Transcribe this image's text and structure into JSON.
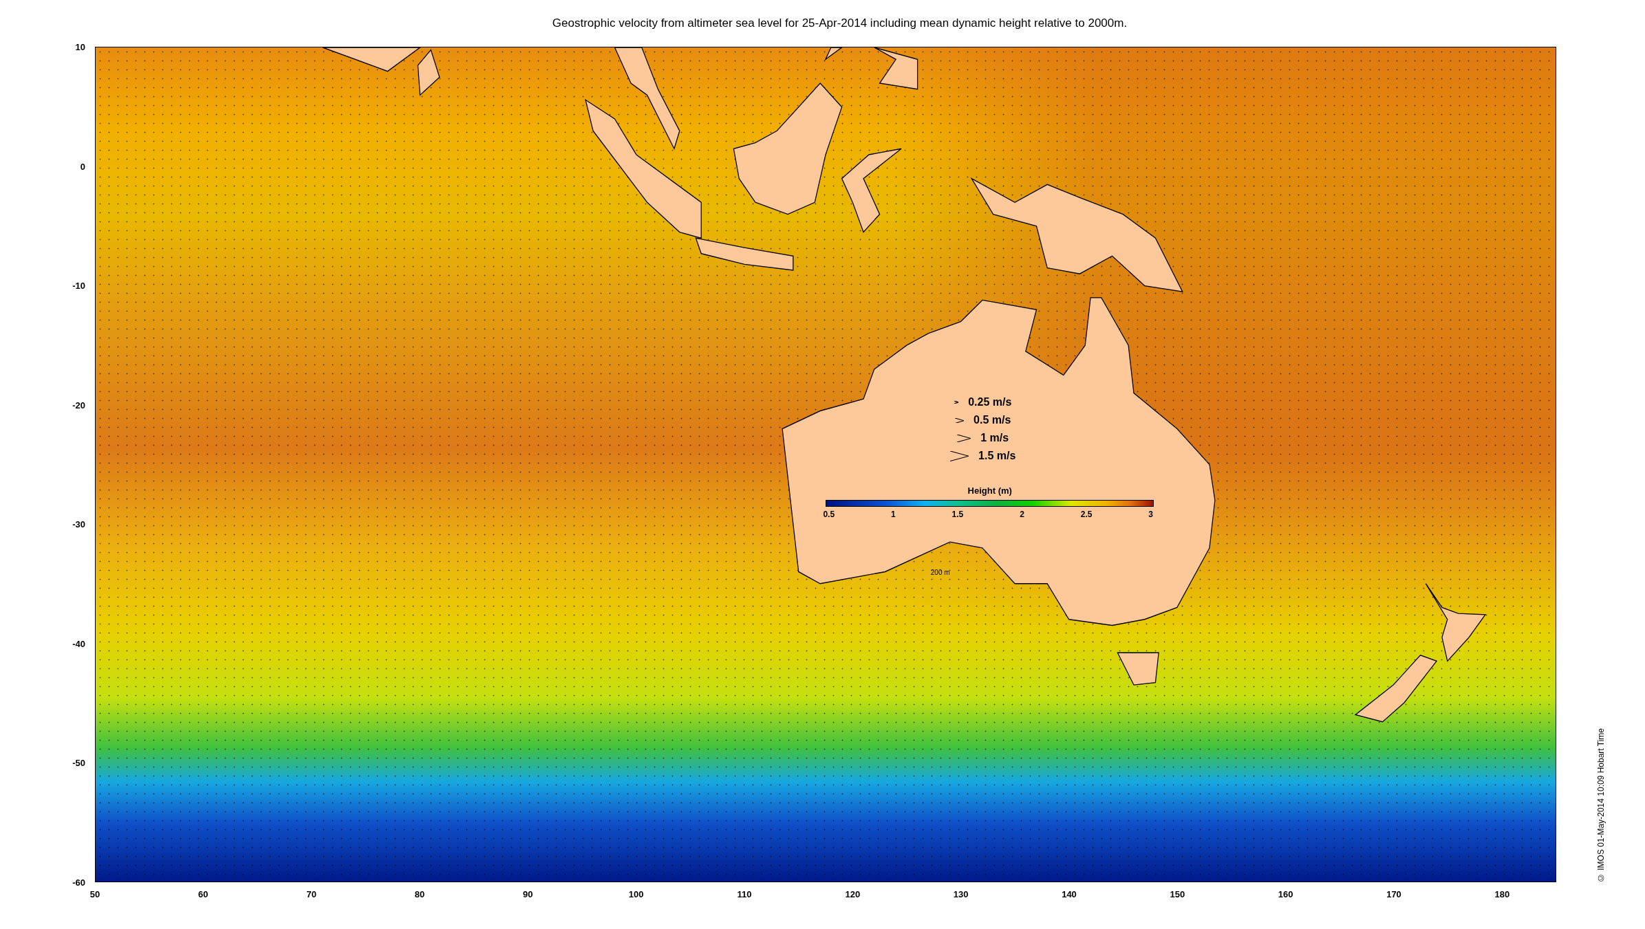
{
  "title": "Geostrophic velocity from altimeter sea level for 25-Apr-2014 including mean dynamic height relative to 2000m.",
  "y_axis_labels": [
    "10",
    "0",
    "-10",
    "-20",
    "-30",
    "-40",
    "-50",
    "-60"
  ],
  "x_axis_labels": [
    "50",
    "60",
    "70",
    "80",
    "90",
    "100",
    "110",
    "120",
    "130",
    "140",
    "150",
    "160",
    "170",
    "180"
  ],
  "speed_legend": [
    {
      "label": "0.25 m/s"
    },
    {
      "label": "0.5 m/s"
    },
    {
      "label": "1 m/s"
    },
    {
      "label": "1.5 m/s"
    }
  ],
  "colorbar": {
    "title": "Height (m)",
    "ticks": [
      "0.5",
      "1",
      "1.5",
      "2",
      "2.5",
      "3"
    ]
  },
  "contour_label": "200 m",
  "credit": "© IMOS 01-May-2014 10:09 Hobart Time"
}
